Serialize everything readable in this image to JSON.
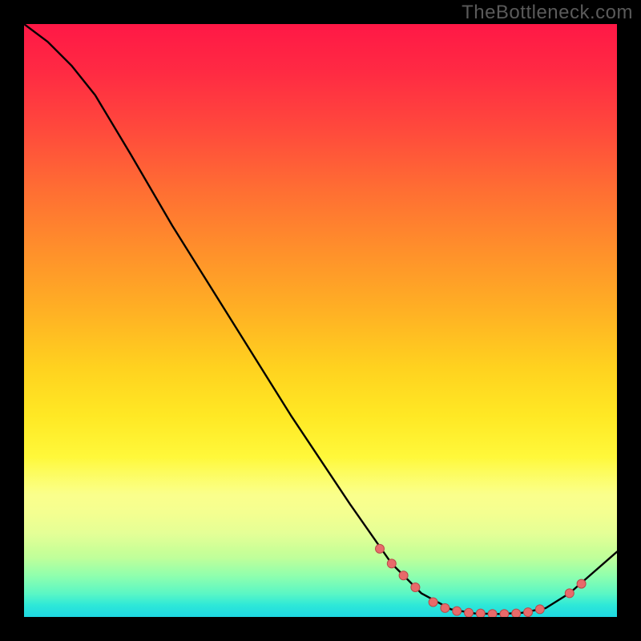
{
  "watermark": "TheBottleneck.com",
  "colors": {
    "curve": "#000000",
    "marker_fill": "#e86a6a",
    "marker_stroke": "#b94a4a"
  },
  "chart_data": {
    "type": "line",
    "title": "",
    "xlabel": "",
    "ylabel": "",
    "xlim": [
      0,
      100
    ],
    "ylim": [
      0,
      100
    ],
    "curve": [
      {
        "x": 0,
        "y": 100
      },
      {
        "x": 4,
        "y": 97
      },
      {
        "x": 8,
        "y": 93
      },
      {
        "x": 12,
        "y": 88
      },
      {
        "x": 18,
        "y": 78
      },
      {
        "x": 25,
        "y": 66
      },
      {
        "x": 35,
        "y": 50
      },
      {
        "x": 45,
        "y": 34
      },
      {
        "x": 55,
        "y": 19
      },
      {
        "x": 62,
        "y": 9
      },
      {
        "x": 67,
        "y": 4
      },
      {
        "x": 72,
        "y": 1.3
      },
      {
        "x": 76,
        "y": 0.6
      },
      {
        "x": 80,
        "y": 0.5
      },
      {
        "x": 84,
        "y": 0.7
      },
      {
        "x": 88,
        "y": 1.5
      },
      {
        "x": 92,
        "y": 4
      },
      {
        "x": 96,
        "y": 7.5
      },
      {
        "x": 100,
        "y": 11
      }
    ],
    "markers": [
      {
        "x": 60,
        "y": 11.5
      },
      {
        "x": 62,
        "y": 9
      },
      {
        "x": 64,
        "y": 7
      },
      {
        "x": 66,
        "y": 5
      },
      {
        "x": 69,
        "y": 2.5
      },
      {
        "x": 71,
        "y": 1.5
      },
      {
        "x": 73,
        "y": 1.0
      },
      {
        "x": 75,
        "y": 0.7
      },
      {
        "x": 77,
        "y": 0.6
      },
      {
        "x": 79,
        "y": 0.5
      },
      {
        "x": 81,
        "y": 0.5
      },
      {
        "x": 83,
        "y": 0.6
      },
      {
        "x": 85,
        "y": 0.8
      },
      {
        "x": 87,
        "y": 1.3
      },
      {
        "x": 92,
        "y": 4
      },
      {
        "x": 94,
        "y": 5.6
      }
    ]
  }
}
